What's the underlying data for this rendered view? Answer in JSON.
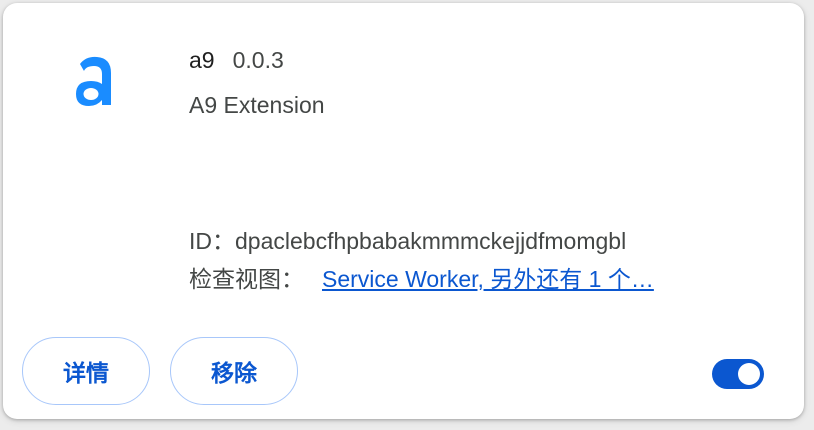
{
  "extension": {
    "name": "a9",
    "version": "0.0.3",
    "description": "A9 Extension",
    "id_label": "ID：",
    "id_value": "dpaclebcfhpbabakmmmckejjdfmomgbl",
    "views_label": "检查视图：",
    "views_link": "Service Worker, 另外还有 1 个…",
    "enabled": true
  },
  "buttons": {
    "details_label": "详情",
    "remove_label": "移除"
  },
  "colors": {
    "accent": "#0b57d0",
    "icon": "#1a8cff",
    "button_border": "#a8c7fa"
  },
  "icons": {
    "extension_icon": "a9-logo-icon"
  }
}
